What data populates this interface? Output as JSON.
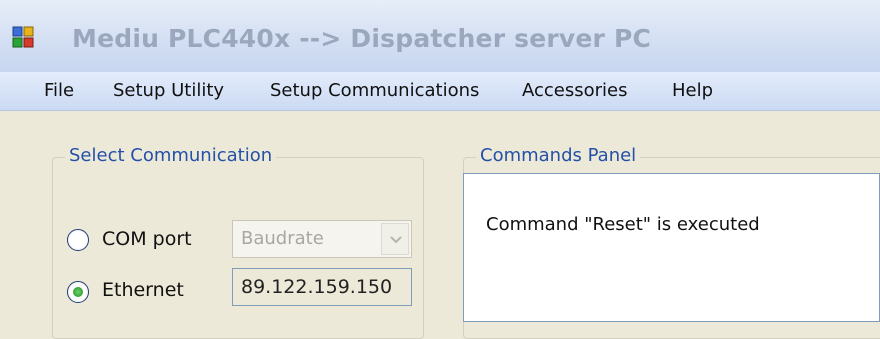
{
  "window": {
    "title": "Mediu PLC440x --> Dispatcher server PC",
    "icon": "app-window-icon"
  },
  "menu": {
    "items": [
      {
        "label": "File"
      },
      {
        "label": "Setup Utility"
      },
      {
        "label": "Setup Communications"
      },
      {
        "label": "Accessories"
      },
      {
        "label": "Help"
      }
    ]
  },
  "select_communication": {
    "legend": "Select Communication",
    "com_port": {
      "label": "COM port",
      "selected": false
    },
    "ethernet": {
      "label": "Ethernet",
      "selected": true
    },
    "baudrate": {
      "placeholder": "Baudrate",
      "enabled": false
    },
    "ip_address": "89.122.159.150"
  },
  "commands_panel": {
    "legend": "Commands Panel",
    "message": "Command \"Reset\" is executed"
  }
}
